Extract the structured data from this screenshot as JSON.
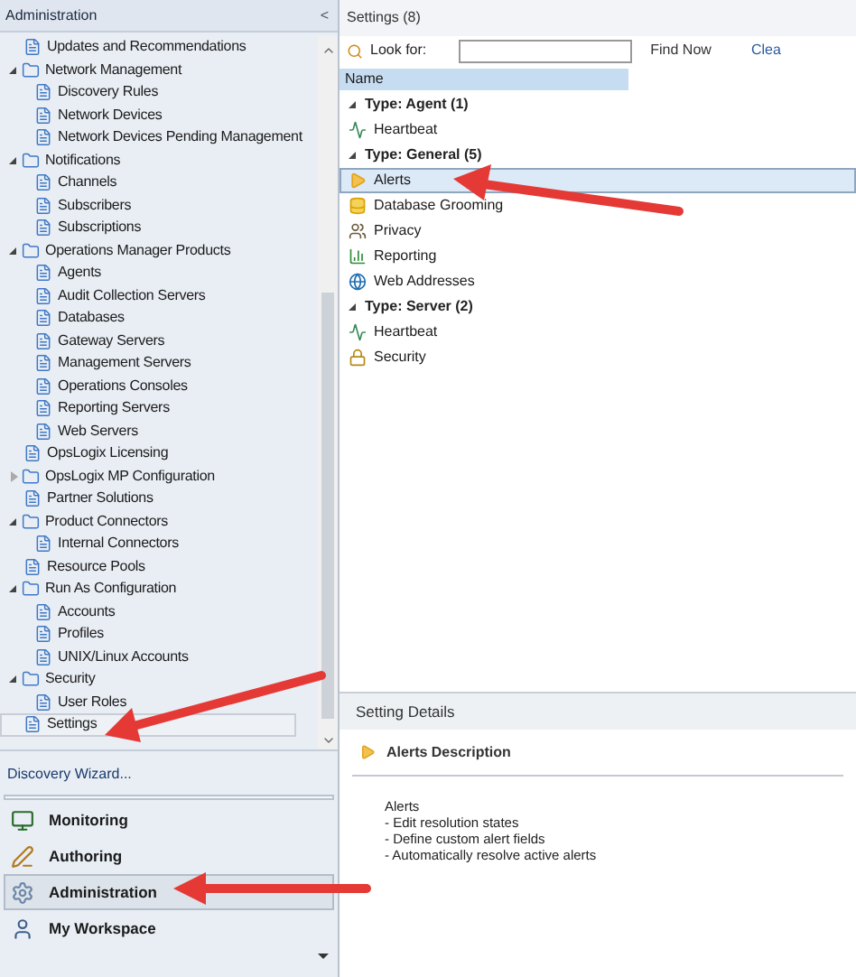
{
  "nav_pane": {
    "title": "Administration",
    "collapse_glyph": "<",
    "tree": [
      {
        "label": "Updates and Recommendations",
        "selected": false
      },
      {
        "label": "Network Management",
        "selected": false,
        "expanded": true,
        "children": [
          {
            "label": "Discovery Rules",
            "selected": false
          },
          {
            "label": "Network Devices",
            "selected": false
          },
          {
            "label": "Network Devices Pending Management",
            "selected": false
          }
        ]
      },
      {
        "label": "Notifications",
        "selected": false,
        "expanded": true,
        "children": [
          {
            "label": "Channels",
            "selected": false
          },
          {
            "label": "Subscribers",
            "selected": false
          },
          {
            "label": "Subscriptions",
            "selected": false
          }
        ]
      },
      {
        "label": "Operations Manager Products",
        "selected": false,
        "expanded": true,
        "children": [
          {
            "label": "Agents",
            "selected": false
          },
          {
            "label": "Audit Collection Servers",
            "selected": false
          },
          {
            "label": "Databases",
            "selected": false
          },
          {
            "label": "Gateway Servers",
            "selected": false
          },
          {
            "label": "Management Servers",
            "selected": false
          },
          {
            "label": "Operations Consoles",
            "selected": false
          },
          {
            "label": "Reporting Servers",
            "selected": false
          },
          {
            "label": "Web Servers",
            "selected": false
          }
        ]
      },
      {
        "label": "OpsLogix Licensing",
        "selected": false
      },
      {
        "label": "OpsLogix MP Configuration",
        "selected": false,
        "expanded": false
      },
      {
        "label": "Partner Solutions",
        "selected": false
      },
      {
        "label": "Product Connectors",
        "selected": false,
        "expanded": true,
        "children": [
          {
            "label": "Internal Connectors",
            "selected": false
          }
        ]
      },
      {
        "label": "Resource Pools",
        "selected": false
      },
      {
        "label": "Run As Configuration",
        "selected": false,
        "expanded": true,
        "children": [
          {
            "label": "Accounts",
            "selected": false
          },
          {
            "label": "Profiles",
            "selected": false
          },
          {
            "label": "UNIX/Linux Accounts",
            "selected": false
          }
        ]
      },
      {
        "label": "Security",
        "selected": false,
        "expanded": true,
        "children": [
          {
            "label": "User Roles",
            "selected": false
          }
        ]
      },
      {
        "label": "Settings",
        "selected": true
      }
    ],
    "task_link": "Discovery Wizard...",
    "workspaces": [
      {
        "label": "Monitoring",
        "kind": "monitoring",
        "selected": false
      },
      {
        "label": "Authoring",
        "kind": "authoring",
        "selected": false
      },
      {
        "label": "Administration",
        "kind": "administration",
        "selected": true
      },
      {
        "label": "My Workspace",
        "kind": "workspace",
        "selected": false
      }
    ]
  },
  "results_pane": {
    "title": "Settings (8)",
    "search": {
      "label": "Look for:",
      "find_button": "Find Now",
      "clear_button": "Clea"
    },
    "column": "Name",
    "groups": [
      {
        "label": "Type: Agent (1)",
        "expanded": true,
        "items": [
          {
            "label": "Heartbeat",
            "kind": "heartbeat",
            "selected": false
          }
        ]
      },
      {
        "label": "Type: General (5)",
        "expanded": true,
        "items": [
          {
            "label": "Alerts",
            "kind": "alert",
            "selected": true
          },
          {
            "label": "Database Grooming",
            "kind": "database",
            "selected": false
          },
          {
            "label": "Privacy",
            "kind": "privacy",
            "selected": false
          },
          {
            "label": "Reporting",
            "kind": "report",
            "selected": false
          },
          {
            "label": "Web Addresses",
            "kind": "web",
            "selected": false
          }
        ]
      },
      {
        "label": "Type: Server (2)",
        "expanded": true,
        "items": [
          {
            "label": "Heartbeat",
            "kind": "heartbeat",
            "selected": false
          },
          {
            "label": "Security",
            "kind": "security",
            "selected": false
          }
        ]
      }
    ]
  },
  "details_pane": {
    "title": "Setting Details",
    "heading": "Alerts Description",
    "lines": [
      "Alerts",
      "- Edit resolution states",
      "- Define custom alert fields",
      "- Automatically resolve active alerts"
    ]
  }
}
